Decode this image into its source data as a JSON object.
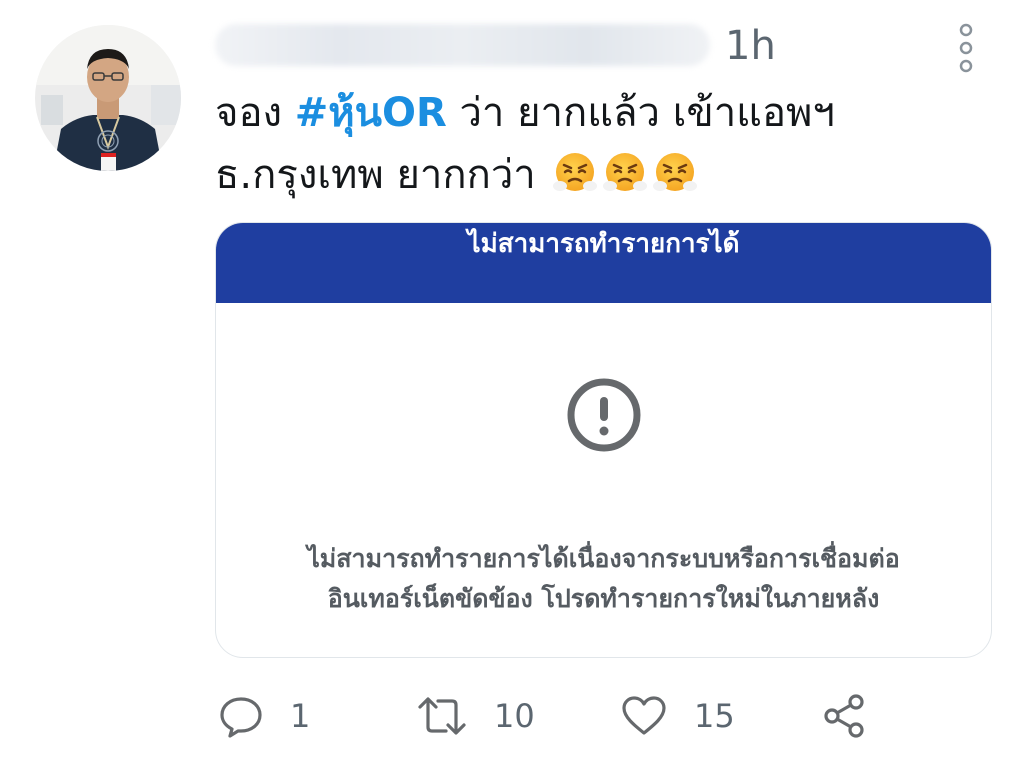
{
  "tweet": {
    "time": "1h",
    "text": {
      "line1_before": "จอง ",
      "hashtag": "#หุ้นOR",
      "line1_after": " ว่า ยากแล้ว เข้าแอพฯ",
      "line2": "ธ.กรุงเทพ ยากกว่า"
    },
    "emojis": [
      "face-with-steam-icon",
      "face-with-steam-icon",
      "face-with-steam-icon"
    ]
  },
  "card": {
    "header_title": "ไม่สามารถทำรายการได้",
    "message_line1": "ไม่สามารถทำรายการได้เนื่องจากระบบหรือการเชื่อมต่อ",
    "message_line2": "อินเทอร์เน็ตขัดข้อง โปรดทำรายการใหม่ในภายหลัง",
    "icon": "exclamation-circle-icon",
    "header_color": "#1f3ea0"
  },
  "actions": {
    "reply_count": "1",
    "retweet_count": "10",
    "like_count": "15"
  },
  "colors": {
    "hashtag": "#1b8ee0",
    "muted": "#5b6670",
    "icon_gray": "#66696c"
  }
}
